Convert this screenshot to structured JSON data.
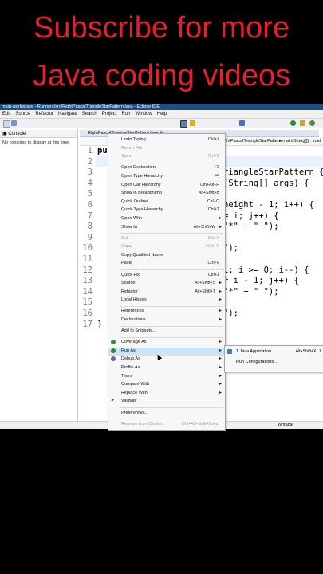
{
  "banner": {
    "line1": "Subscribe for more",
    "line2": "Java coding videos"
  },
  "window": {
    "title": "main-workspace - Runners/src/RightPascalTriangleStarPattern.java - Eclipse IDE"
  },
  "menubar": [
    "Edit",
    "Source",
    "Refactor",
    "Navigate",
    "Search",
    "Project",
    "Run",
    "Window",
    "Help"
  ],
  "console": {
    "tab": "Console",
    "message": "No consoles to display at this time."
  },
  "editor": {
    "tab": "RightPascalTriangleStarPattern.java",
    "breadcrumb_class": "RightPascalTriangleStarPattern",
    "breadcrumb_method": "main(String[]) : void",
    "line_numbers": [
      "1",
      "2",
      "3",
      "4",
      "5",
      "6",
      "7",
      "8",
      "9",
      "10",
      "11",
      "12",
      "13",
      "14",
      "15",
      "16",
      "17"
    ],
    "code_lines": [
      "pu",
      "",
      "riangleStarPattern {",
      "(String[] args) {",
      "",
      "height - 1; i++) {",
      "= i; j++) {",
      "\"*\" + \" \");",
      "",
      "\");",
      "",
      "1; i >= 0; i--) {",
      "= i - 1; j++) {",
      "\"*\" + \" \");",
      "",
      "\");",
      "}"
    ]
  },
  "context_menu": [
    {
      "label": "Undo Typing",
      "shortcut": "Ctrl+Z",
      "disabled": false
    },
    {
      "label": "Revert File",
      "shortcut": "",
      "disabled": true
    },
    {
      "label": "Save",
      "shortcut": "Ctrl+S",
      "disabled": true
    },
    {
      "sep": true
    },
    {
      "label": "Open Declaration",
      "shortcut": "F3"
    },
    {
      "label": "Open Type Hierarchy",
      "shortcut": "F4"
    },
    {
      "label": "Open Call Hierarchy",
      "shortcut": "Ctrl+Alt+H"
    },
    {
      "label": "Show in Breadcrumb",
      "shortcut": "Alt+Shift+B"
    },
    {
      "label": "Quick Outline",
      "shortcut": "Ctrl+O"
    },
    {
      "label": "Quick Type Hierarchy",
      "shortcut": "Ctrl+T"
    },
    {
      "label": "Open With",
      "arrow": true
    },
    {
      "label": "Show In",
      "shortcut": "Alt+Shift+W",
      "arrow": true
    },
    {
      "sep": true
    },
    {
      "label": "Cut",
      "shortcut": "Ctrl+X",
      "disabled": true
    },
    {
      "label": "Copy",
      "shortcut": "Ctrl+C",
      "disabled": true
    },
    {
      "label": "Copy Qualified Name"
    },
    {
      "label": "Paste",
      "shortcut": "Ctrl+V"
    },
    {
      "sep": true
    },
    {
      "label": "Quick Fix",
      "shortcut": "Ctrl+1"
    },
    {
      "label": "Source",
      "shortcut": "Alt+Shift+S",
      "arrow": true
    },
    {
      "label": "Refactor",
      "shortcut": "Alt+Shift+T",
      "arrow": true
    },
    {
      "label": "Local History",
      "arrow": true
    },
    {
      "sep": true
    },
    {
      "label": "References",
      "arrow": true
    },
    {
      "label": "Declarations",
      "arrow": true
    },
    {
      "sep": true
    },
    {
      "label": "Add to Snippets..."
    },
    {
      "sep": true
    },
    {
      "label": "Coverage As",
      "arrow": true,
      "icon": "#3c8a3c"
    },
    {
      "label": "Run As",
      "arrow": true,
      "icon": "#2e8b2e",
      "selected": true
    },
    {
      "label": "Debug As",
      "arrow": true,
      "icon": "#6a6a9a"
    },
    {
      "label": "Profile As",
      "arrow": true
    },
    {
      "label": "Team",
      "arrow": true
    },
    {
      "label": "Compare With",
      "arrow": true
    },
    {
      "label": "Replace With",
      "arrow": true
    },
    {
      "label": "Validate",
      "check": true
    },
    {
      "sep": true
    },
    {
      "label": "Preferences..."
    },
    {
      "sep": true
    },
    {
      "label": "Remove from Context",
      "shortcut": "Ctrl+Alt+Shift+Down",
      "disabled": true
    }
  ],
  "submenu": [
    {
      "label": "1 Java Application",
      "shortcut": "Alt+Shift+X, J"
    },
    {
      "label": "Run Configurations...",
      "shortcut": ""
    }
  ],
  "statusbar": {
    "mode": "Writable"
  },
  "colors": {
    "banner": "#e5202a",
    "titlebar": "#1f4f82",
    "selection": "#cce4f7"
  }
}
